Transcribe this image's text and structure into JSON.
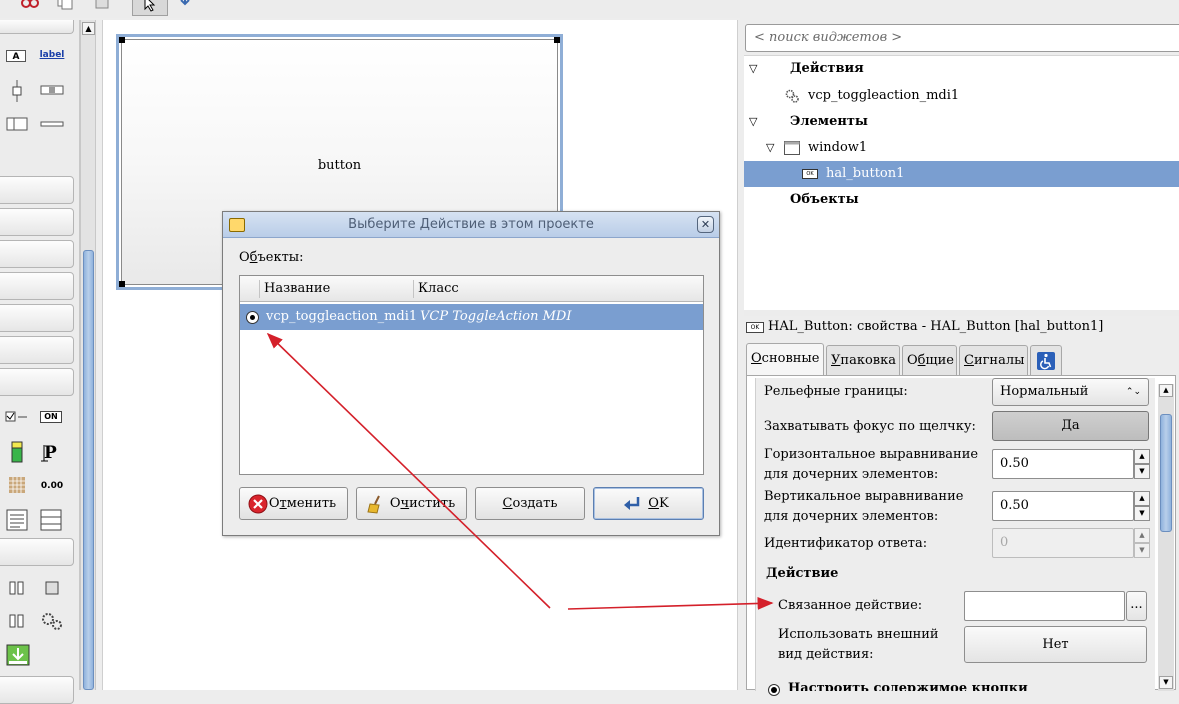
{
  "canvas": {
    "button_label": "button"
  },
  "search": {
    "placeholder": "< поиск виджетов >"
  },
  "tree": {
    "actions_header": "Действия",
    "action_item": "vcp_toggleaction_mdi1",
    "elements_header": "Элементы",
    "window_item": "window1",
    "button_item": "hal_button1",
    "objects_header": "Объекты"
  },
  "properties": {
    "title": "HAL_Button: свойства - HAL_Button [hal_button1]",
    "tabs": [
      {
        "underline": "О",
        "rest": "сновные"
      },
      {
        "underline": "У",
        "rest": "паковка"
      },
      {
        "pre": "О",
        "underline": "б",
        "rest": "щие"
      },
      {
        "underline": "С",
        "rest": "игналы"
      }
    ],
    "relief_label": "Рельефные границы:",
    "relief_value": "Нормальный",
    "focus_label": "Захватывать фокус по щелчку:",
    "focus_value": "Да",
    "halign_label_1": "Горизонтальное выравнивание",
    "halign_label_2": "для дочерних элементов:",
    "halign_value": "0.50",
    "valign_label_1": "Вертикальное выравнивание",
    "valign_label_2": "для дочерних элементов:",
    "valign_value": "0.50",
    "response_label": "Идентификатор ответа:",
    "response_value": "0",
    "action_section": "Действие",
    "related_action_label": "Связанное действие:",
    "related_action_value": "",
    "browse_label": "...",
    "use_appearance_label_1": "Использовать внешний",
    "use_appearance_label_2": "вид действия:",
    "use_appearance_value": "Нет",
    "configure_label": "Настроить содержимое кнопки"
  },
  "dialog": {
    "title": "Выберите Действие в этом проекте",
    "objects_label_pre": "О",
    "objects_label_u": "б",
    "objects_label_post": "ъекты:",
    "col_name": "Название",
    "col_class": "Класс",
    "row_name": "vcp_toggleaction_mdi1",
    "row_class": "VCP ToggleAction MDI",
    "btn_cancel_pre": "О",
    "btn_cancel_u": "т",
    "btn_cancel_post": "менить",
    "btn_clear_pre": "О",
    "btn_clear_u": "ч",
    "btn_clear_post": "истить",
    "btn_create_u": "С",
    "btn_create_post": "оздать",
    "btn_ok_u": "O",
    "btn_ok_post": "K"
  },
  "palette": {
    "label_widget": "label",
    "on_widget": "ON",
    "spin_widget": "0.00"
  },
  "colors": {
    "selection": "#7a9ed0",
    "annotation_arrow": "#d4202a"
  }
}
